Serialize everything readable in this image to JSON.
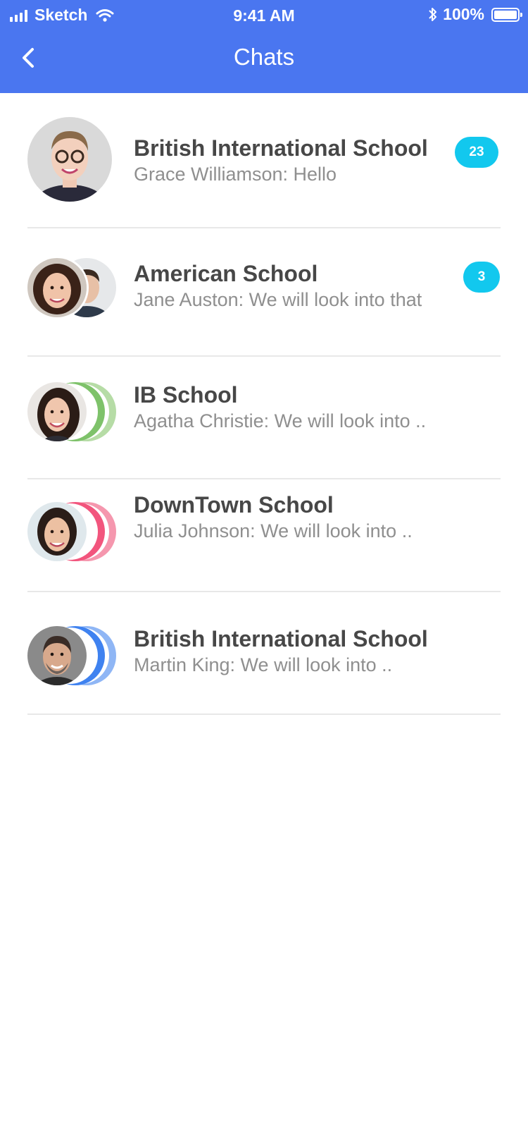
{
  "status_bar": {
    "carrier": "Sketch",
    "time": "9:41 AM",
    "battery": "100%"
  },
  "nav": {
    "title": "Chats",
    "back_icon": "chevron-left-icon"
  },
  "colors": {
    "header": "#4a76f0",
    "badge": "#12c8ee",
    "ring_green": "#7ec26a",
    "ring_pink": "#f2557d",
    "ring_blue": "#3f82f0"
  },
  "chats": [
    {
      "name": "British International School",
      "preview": "Grace Williamson:  Hello",
      "unread": "23"
    },
    {
      "name": "American School",
      "preview": "Jane Auston: We will look into that",
      "unread": "3"
    },
    {
      "name": "IB School",
      "preview": "Agatha Christie: We will look into .."
    },
    {
      "name": "DownTown School",
      "preview": "Julia Johnson: We will look into .."
    },
    {
      "name": "British International School",
      "preview": "Martin King: We will look into .."
    }
  ]
}
